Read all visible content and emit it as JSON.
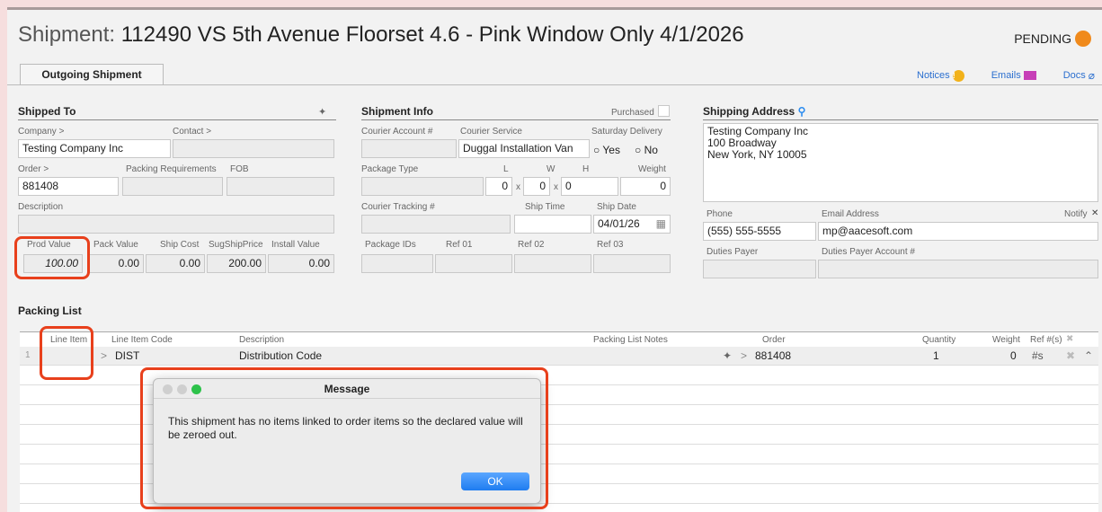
{
  "header": {
    "title_label": "Shipment:",
    "title_value": "112490 VS 5th Avenue Floorset 4.6 - Pink Window Only  4/1/2026",
    "status": "PENDING",
    "status_color": "#f08a1c"
  },
  "tabs": [
    {
      "label": "Outgoing Shipment"
    }
  ],
  "links": {
    "notices": "Notices",
    "emails": "Emails",
    "docs": "Docs"
  },
  "shipped_to": {
    "heading": "Shipped To",
    "company_label": "Company >",
    "contact_label": "Contact >",
    "company": "Testing Company Inc",
    "contact": "",
    "order_label": "Order >",
    "packing_req_label": "Packing Requirements",
    "fob_label": "FOB",
    "order": "881408",
    "description_label": "Description",
    "prod_value_label": "Prod Value",
    "pack_value_label": "Pack Value",
    "ship_cost_label": "Ship Cost",
    "sug_ship_price_label": "SugShipPrice",
    "install_value_label": "Install Value",
    "prod_value": "100.00",
    "pack_value": "0.00",
    "ship_cost": "0.00",
    "sug_ship_price": "200.00",
    "install_value": "0.00"
  },
  "shipment_info": {
    "heading": "Shipment Info",
    "purchased_label": "Purchased",
    "courier_account_label": "Courier Account #",
    "courier_service_label": "Courier Service",
    "saturday_delivery_label": "Saturday Delivery",
    "courier_service": "Duggal Installation Van",
    "yes_label": "Yes",
    "no_label": "No",
    "package_type_label": "Package Type",
    "l_label": "L",
    "w_label": "W",
    "h_label": "H",
    "weight_label": "Weight",
    "l": "0",
    "w": "0",
    "h": "0",
    "weight": "0",
    "x_sep": "x",
    "tracking_label": "Courier Tracking #",
    "ship_time_label": "Ship Time",
    "ship_date_label": "Ship Date",
    "ship_date": "04/01/26",
    "package_ids_label": "Package IDs",
    "ref01_label": "Ref 01",
    "ref02_label": "Ref 02",
    "ref03_label": "Ref 03"
  },
  "shipping_address": {
    "heading": "Shipping Address",
    "line1": "Testing Company Inc",
    "line2": "100 Broadway",
    "line3": "New York, NY 10005",
    "phone_label": "Phone",
    "email_label": "Email Address",
    "notify_label": "Notify",
    "phone": "(555) 555-5555",
    "email": "mp@aacesoft.com",
    "duties_payer_label": "Duties Payer",
    "duties_account_label": "Duties Payer Account #"
  },
  "packing_list": {
    "heading": "Packing List",
    "columns": {
      "line_item": "Line Item",
      "code": "Line Item Code",
      "description": "Description",
      "notes": "Packing List Notes",
      "order": "Order",
      "quantity": "Quantity",
      "weight": "Weight",
      "refs": "Ref #(s)"
    },
    "rows": [
      {
        "num": "1",
        "code": "DIST",
        "description": "Distribution Code",
        "order": "881408",
        "quantity": "1",
        "weight": "0",
        "refs": "#s"
      }
    ]
  },
  "dialog": {
    "title": "Message",
    "message": "This shipment has no items linked to order items so the declared value will be zeroed out.",
    "ok_label": "OK"
  }
}
